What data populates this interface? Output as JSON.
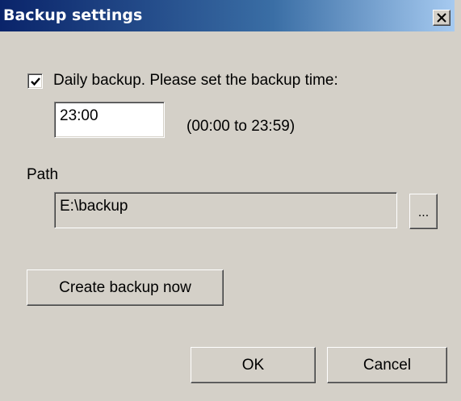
{
  "window": {
    "title": "Backup settings",
    "close_icon": "close-x-icon"
  },
  "daily_backup": {
    "checked": true,
    "label": "Daily backup. Please set the backup time:",
    "time_value": "23:00",
    "time_range_hint": "(00:00 to 23:59)"
  },
  "path": {
    "label": "Path",
    "value": "E:\\backup",
    "browse_label": "..."
  },
  "actions": {
    "create_backup_label": "Create backup now",
    "ok_label": "OK",
    "cancel_label": "Cancel"
  },
  "colors": {
    "face": "#d4d0c8",
    "titlebar_start": "#0a246a",
    "titlebar_end": "#a6caf0",
    "title_text": "#ffffff"
  }
}
